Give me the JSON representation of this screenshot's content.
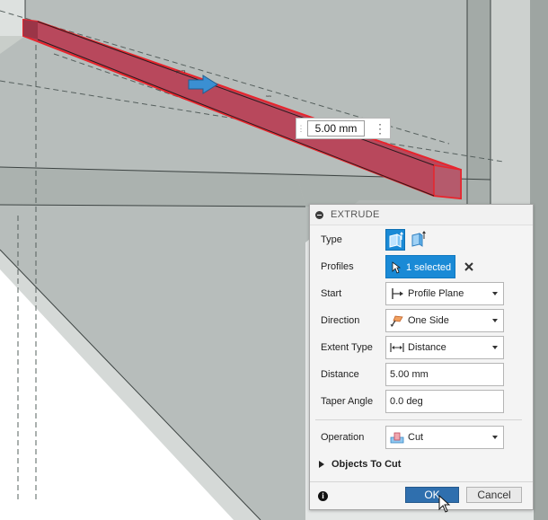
{
  "distance_manipulator": {
    "value": "5.00 mm"
  },
  "dialog": {
    "title": "EXTRUDE",
    "type": {
      "label": "Type"
    },
    "profiles": {
      "label": "Profiles",
      "selection": "1 selected"
    },
    "start": {
      "label": "Start",
      "value": "Profile Plane"
    },
    "direction": {
      "label": "Direction",
      "value": "One Side"
    },
    "extent_type": {
      "label": "Extent Type",
      "value": "Distance"
    },
    "distance": {
      "label": "Distance",
      "value": "5.00 mm"
    },
    "taper_angle": {
      "label": "Taper Angle",
      "value": "0.0 deg"
    },
    "operation": {
      "label": "Operation",
      "value": "Cut"
    },
    "objects_to_cut": {
      "label": "Objects To Cut"
    },
    "buttons": {
      "ok": "OK",
      "cancel": "Cancel"
    }
  },
  "colors": {
    "accent": "#1a8ad6",
    "ok_button": "#2f6fae",
    "selection_fill": "#b8485c",
    "selection_outline": "#e8242c",
    "model_face": "#b9bfbc"
  },
  "icons": [
    "collapse-icon",
    "extrude-type-icon",
    "thin-extrude-icon",
    "select-cursor-icon",
    "clear-selection-icon",
    "profile-plane-icon",
    "one-side-icon",
    "distance-icon",
    "cut-icon",
    "expand-triangle-icon",
    "info-icon",
    "arrow-manipulator-icon",
    "mouse-cursor-icon"
  ]
}
